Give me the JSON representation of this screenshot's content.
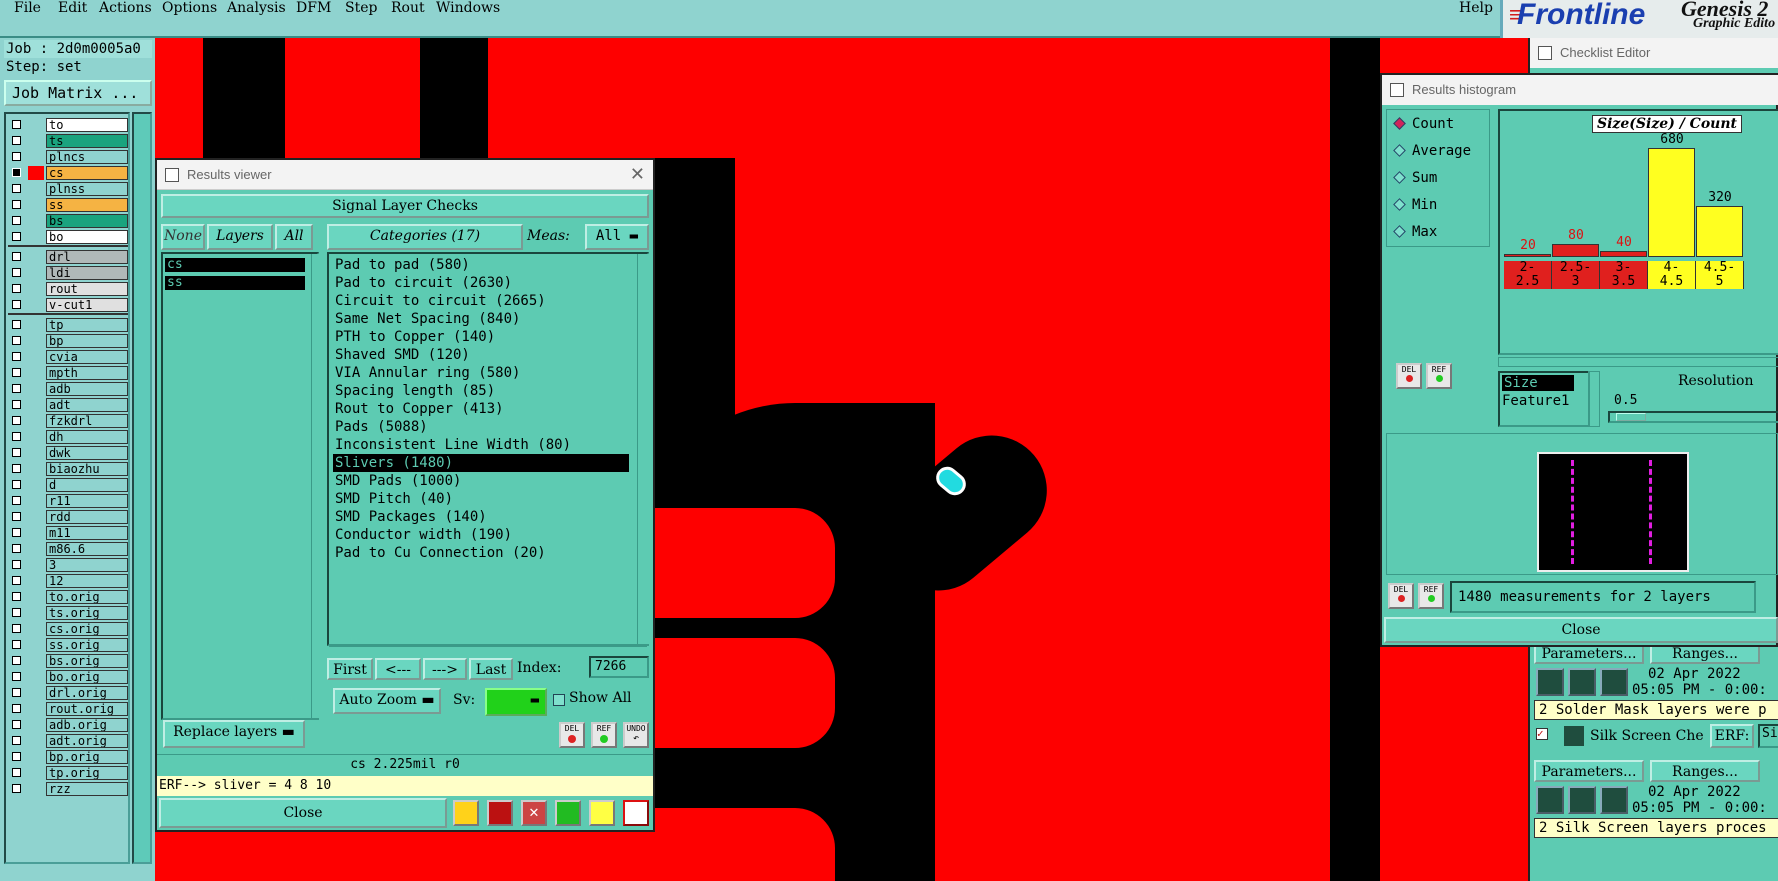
{
  "menubar": {
    "items": [
      "File",
      "Edit",
      "Actions",
      "Options",
      "Analysis",
      "DFM",
      "Step",
      "Rout",
      "Windows"
    ],
    "help": "Help",
    "brand": {
      "logo": "Frontline",
      "product": "Genesis 2",
      "subtitle": "Graphic Edito"
    }
  },
  "left_panel": {
    "job": "Job : 2d0m0005a0",
    "step": "Step: set",
    "job_matrix": "Job Matrix ...",
    "layers": [
      {
        "name": "to",
        "color": "#ffffff"
      },
      {
        "name": "ts",
        "color": "#1aa37e"
      },
      {
        "name": "plncs",
        "color": "#8fd3cf"
      },
      {
        "name": "cs",
        "color": "#f5b343",
        "active": true
      },
      {
        "name": "plnss",
        "color": "#8fd3cf"
      },
      {
        "name": "ss",
        "color": "#f5b343"
      },
      {
        "name": "bs",
        "color": "#1aa37e"
      },
      {
        "name": "bo",
        "color": "#ffffff"
      },
      {
        "name": "drl",
        "color": "#b0b8b8"
      },
      {
        "name": "ldi",
        "color": "#b0b8b8"
      },
      {
        "name": "rout",
        "color": "#e0e0e0"
      },
      {
        "name": "v-cut1",
        "color": "#e0e0e0"
      },
      {
        "name": "tp",
        "color": "#8fd3cf"
      },
      {
        "name": "bp",
        "color": "#8fd3cf"
      },
      {
        "name": "cvia",
        "color": "#8fd3cf"
      },
      {
        "name": "mpth",
        "color": "#8fd3cf"
      },
      {
        "name": "adb",
        "color": "#8fd3cf"
      },
      {
        "name": "adt",
        "color": "#8fd3cf"
      },
      {
        "name": "fzkdrl",
        "color": "#8fd3cf"
      },
      {
        "name": "dh",
        "color": "#8fd3cf"
      },
      {
        "name": "dwk",
        "color": "#8fd3cf"
      },
      {
        "name": "biaozhu",
        "color": "#8fd3cf"
      },
      {
        "name": "d",
        "color": "#8fd3cf"
      },
      {
        "name": "r11",
        "color": "#8fd3cf"
      },
      {
        "name": "rdd",
        "color": "#8fd3cf"
      },
      {
        "name": "m11",
        "color": "#8fd3cf"
      },
      {
        "name": "m86.6",
        "color": "#8fd3cf"
      },
      {
        "name": "3",
        "color": "#8fd3cf"
      },
      {
        "name": "12",
        "color": "#8fd3cf"
      },
      {
        "name": "to.orig",
        "color": "#8fd3cf",
        "arrow": true
      },
      {
        "name": "ts.orig",
        "color": "#8fd3cf",
        "arrow": true
      },
      {
        "name": "cs.orig",
        "color": "#8fd3cf",
        "arrow": true
      },
      {
        "name": "ss.orig",
        "color": "#8fd3cf",
        "arrow": true
      },
      {
        "name": "bs.orig",
        "color": "#8fd3cf",
        "arrow": true
      },
      {
        "name": "bo.orig",
        "color": "#8fd3cf",
        "arrow": true
      },
      {
        "name": "drl.orig",
        "color": "#8fd3cf"
      },
      {
        "name": "rout.orig",
        "color": "#8fd3cf"
      },
      {
        "name": "adb.orig",
        "color": "#8fd3cf",
        "arrow": true
      },
      {
        "name": "adt.orig",
        "color": "#8fd3cf",
        "arrow": true
      },
      {
        "name": "bp.orig",
        "color": "#8fd3cf",
        "arrow": true
      },
      {
        "name": "tp.orig",
        "color": "#8fd3cf",
        "arrow": true
      },
      {
        "name": "rzz",
        "color": "#8fd3cf"
      }
    ]
  },
  "results_viewer": {
    "title": "Results viewer",
    "header": "Signal Layer Checks",
    "none_btn": "None",
    "layers_btn": "Layers",
    "all_btn": "All",
    "categories_btn": "Categories (17)",
    "meas_label": "Meas:",
    "meas_value": "All",
    "layers": [
      "cs",
      "ss"
    ],
    "categories": [
      "Pad to pad (580)",
      "Pad to circuit (2630)",
      "Circuit to circuit (2665)",
      "Same Net Spacing (840)",
      "PTH to Copper (140)",
      "Shaved SMD (120)",
      "VIA Annular ring (580)",
      "Spacing length (85)",
      "Rout to Copper (413)",
      "Pads (5088)",
      "Inconsistent Line Width (80)",
      "Slivers (1480)",
      "SMD Pads (1000)",
      "SMD Pitch (40)",
      "SMD Packages (140)",
      "Conductor width (190)",
      "Pad to Cu Connection (20)"
    ],
    "selected_category": 11,
    "first_btn": "First",
    "prev_btn": "<---",
    "next_btn": "--->",
    "last_btn": "Last",
    "index_label": "Index:",
    "index_value": "7266",
    "auto_zoom": "Auto Zoom",
    "sv_label": "Sv:",
    "show_all": "Show All",
    "replace_layers": "Replace layers",
    "del": "DEL",
    "ref": "REF",
    "undo": "UNDO",
    "status": "cs 2.225mil  r0",
    "erf": "ERF--> sliver = 4 8 10",
    "close": "Close"
  },
  "histogram": {
    "title": "Results histogram",
    "modes": [
      "Count",
      "Average",
      "Sum",
      "Min",
      "Max"
    ],
    "selected_mode": "Count",
    "chart_title": "Size(Size) / Count",
    "bins": [
      {
        "label": "2-\n2.5",
        "count": 20,
        "color": "#e0201e"
      },
      {
        "label": "2.5-\n3",
        "count": 80,
        "color": "#e0201e"
      },
      {
        "label": "3-\n3.5",
        "count": 40,
        "color": "#e0201e"
      },
      {
        "label": "4-\n4.5",
        "count": 680,
        "color": "#ffff20"
      },
      {
        "label": "4.5-\n5",
        "count": 320,
        "color": "#ffff20"
      }
    ],
    "param_list": [
      "Size",
      "Feature1"
    ],
    "resolution_label": "Resolution",
    "resolution_value": "0.5",
    "summary": "1480 measurements for 2 layers",
    "del": "DEL",
    "ref": "REF",
    "close": "Close"
  },
  "checklist": {
    "title": "Checklist Editor",
    "parameters": "Parameters...",
    "ranges": "Ranges...",
    "date1": "02 Apr 2022",
    "time1": "05:05 PM - 0:00:",
    "msg1": "2 Solder Mask layers were p",
    "silk_label": "Silk Screen Che",
    "erf_label": "ERF:",
    "erf_value": "Sil",
    "date2": "02 Apr 2022",
    "time2": "05:05 PM - 0:00:",
    "msg2": "2 Silk Screen layers proces"
  }
}
